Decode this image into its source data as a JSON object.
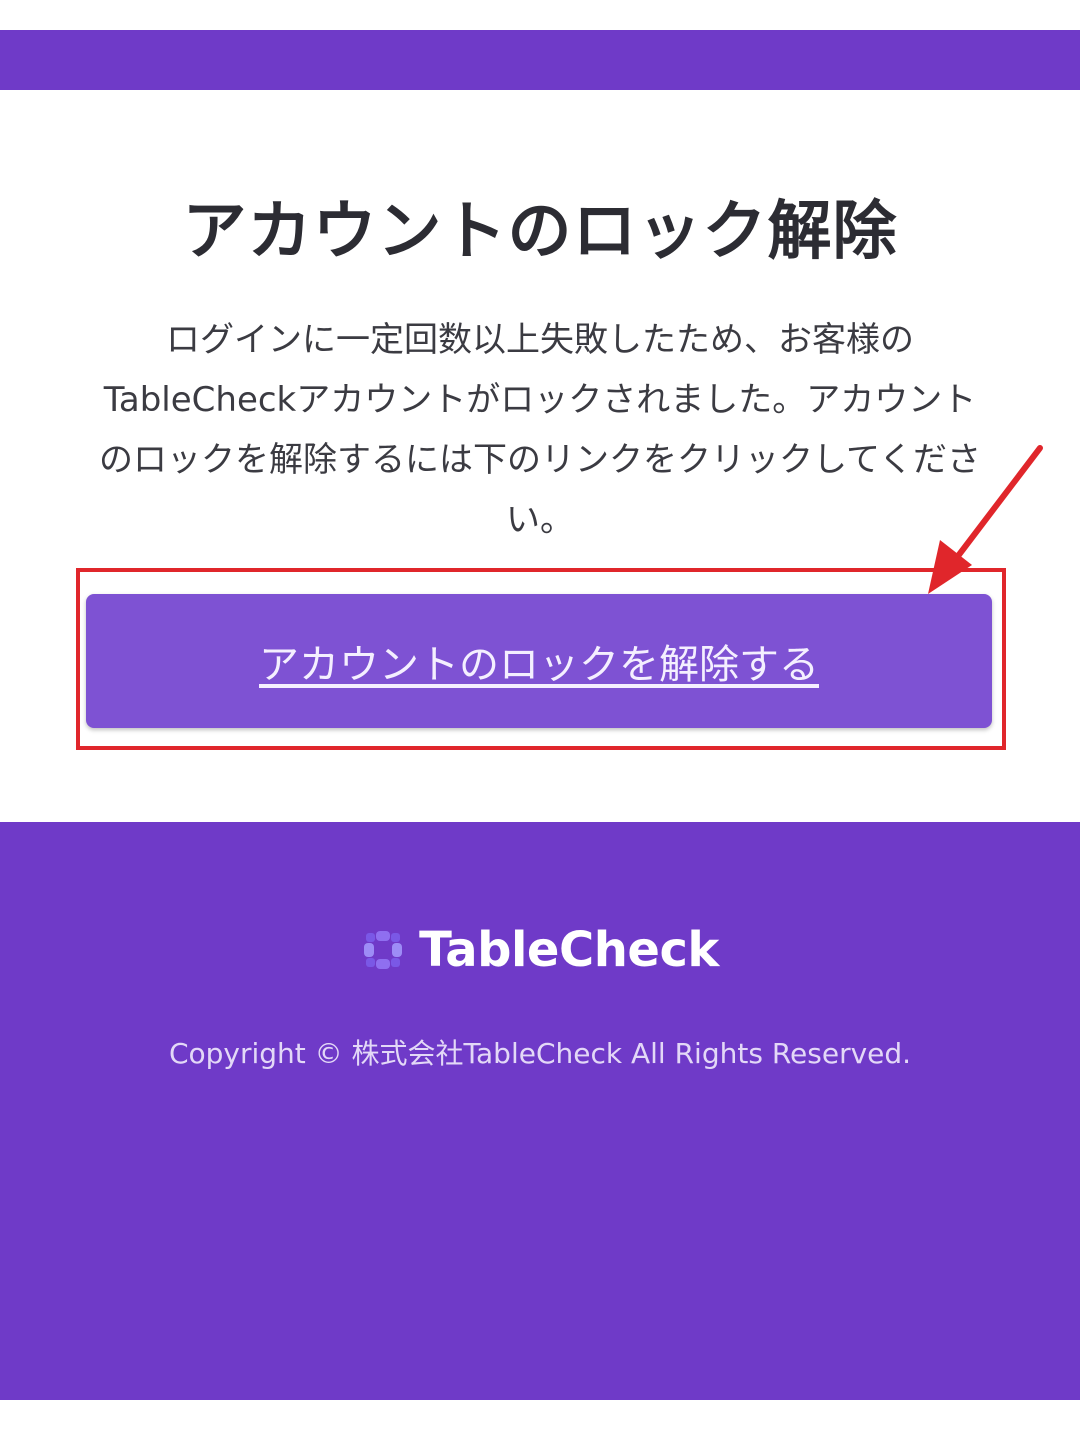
{
  "header": {
    "band_color": "#6f3ac8"
  },
  "main": {
    "title": "アカウントのロック解除",
    "message": "ログインに一定回数以上失敗したため、お客様のTableCheckアカウントがロックされました。アカウントのロックを解除するには下のリンクをクリックしてください。",
    "unlock_button_label": "アカウントのロックを解除する",
    "button_color": "#7e52d3"
  },
  "annotation": {
    "highlight_color": "#e0262b",
    "arrow_color": "#e0262b"
  },
  "footer": {
    "logo_text": "TableCheck",
    "logo_icon": "tablecheck-logo-icon",
    "copyright": "Copyright © 株式会社TableCheck All Rights Reserved.",
    "background_color": "#6f3ac8"
  }
}
